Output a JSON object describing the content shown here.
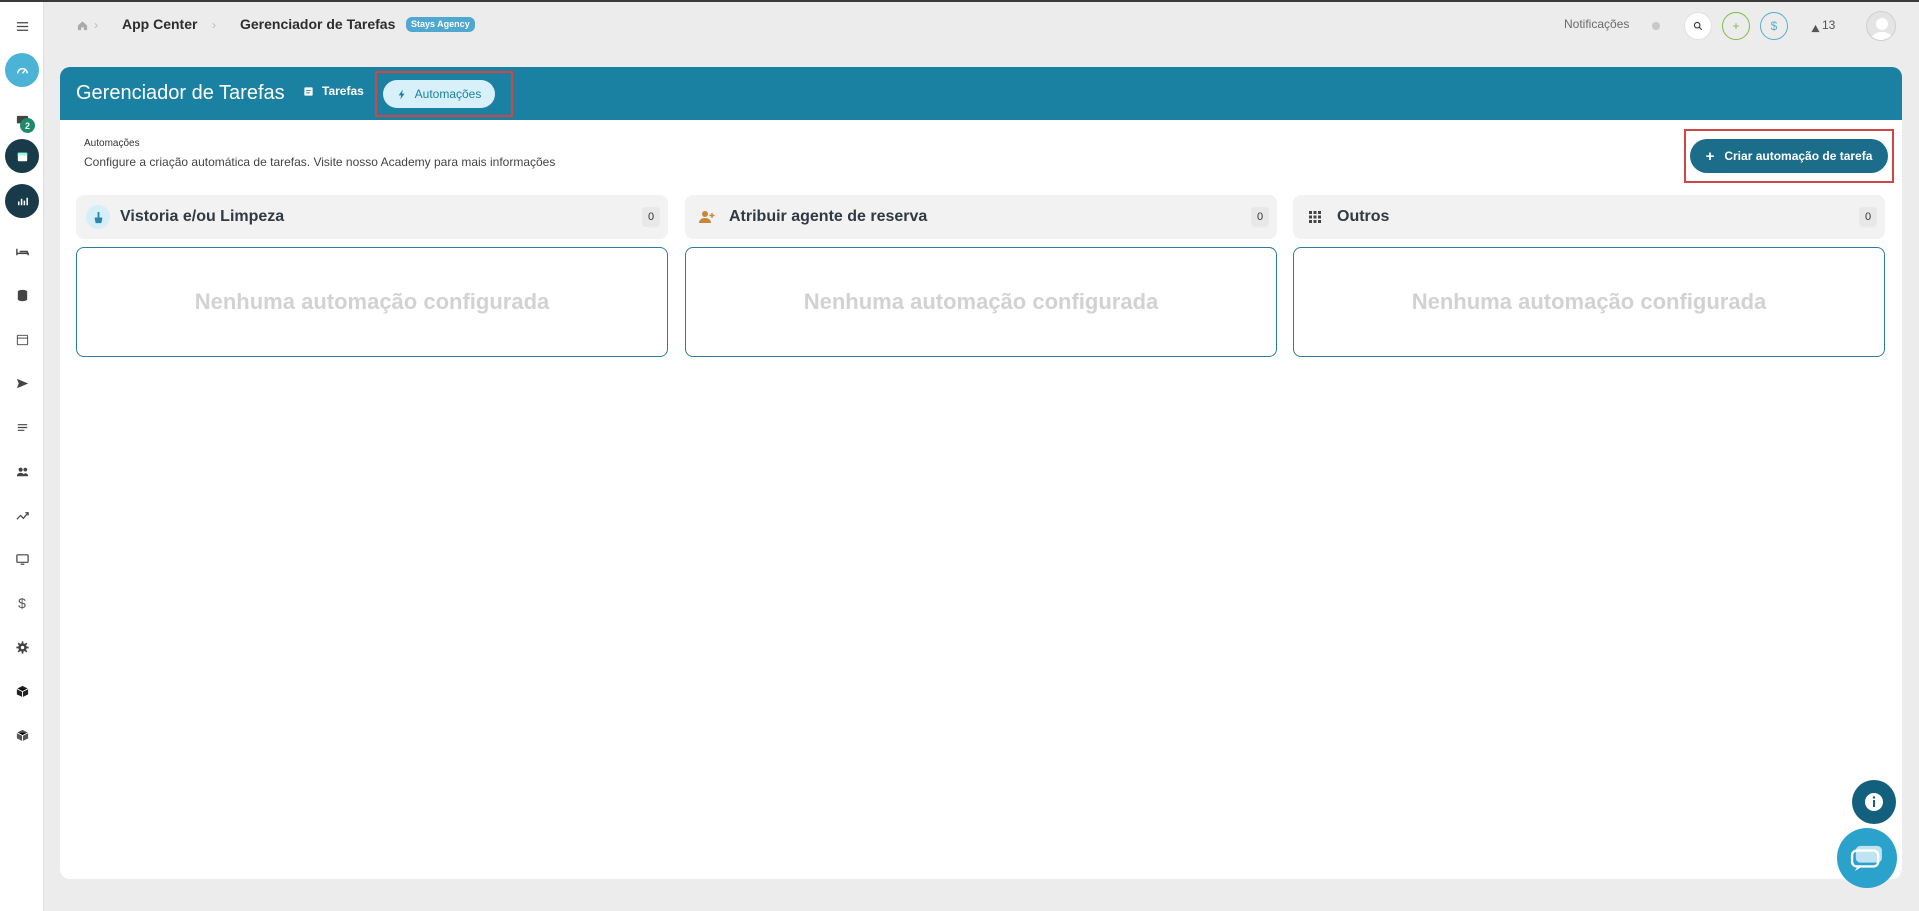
{
  "breadcrumb": {
    "app_center": "App Center",
    "task_manager": "Gerenciador de Tarefas",
    "agency_badge": "Stays Agency"
  },
  "topbar": {
    "notifications_label": "Notificações",
    "alert_count": "13",
    "plus_icon": "+",
    "dollar_icon": "$"
  },
  "sidebar": {
    "messages_badge": "2",
    "items": [
      "menu-icon",
      "dashboard-icon",
      "messages-icon",
      "calendar-icon",
      "reports-icon",
      "bed-icon",
      "database-icon",
      "calendar-outline-icon",
      "send-icon",
      "list-icon",
      "people-icon",
      "trending-icon",
      "monitor-icon",
      "dollar-icon",
      "gear-icon",
      "box-icon",
      "cube-icon"
    ]
  },
  "panel": {
    "title": "Gerenciador de Tarefas",
    "tabs": [
      {
        "label": "Tarefas"
      },
      {
        "label": "Automações"
      }
    ],
    "section_label": "Automações",
    "section_desc": "Configure a criação automática de tarefas. Visite nosso Academy para mais informações",
    "create_button": "Criar automação de tarefa",
    "columns": [
      {
        "title": "Vistoria e/ou Limpeza",
        "count": "0",
        "empty": "Nenhuma automação configurada"
      },
      {
        "title": "Atribuir agente de reserva",
        "count": "0",
        "empty": "Nenhuma automação configurada"
      },
      {
        "title": "Outros",
        "count": "0",
        "empty": "Nenhuma automação configurada"
      }
    ]
  },
  "colors": {
    "header": "#1b81a3",
    "create_button": "#1b6d8a",
    "highlight": "#d24545",
    "card_border": "#2d7d98"
  }
}
